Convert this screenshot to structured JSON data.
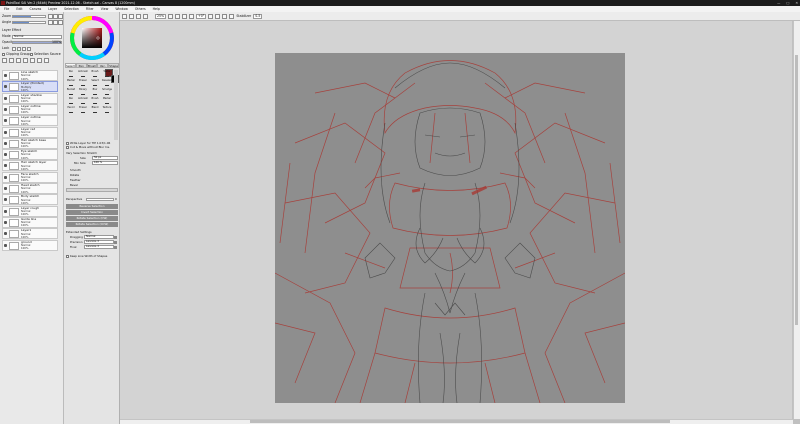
{
  "window": {
    "title": "PaintTool SAI Ver.2 (64bit) Preview 2021.12.06 - Sketch.sai - Canvas 8 (1200mm)",
    "buttons": [
      "—",
      "□",
      "✕"
    ]
  },
  "menu": [
    "File",
    "Edit",
    "Canvas",
    "Layer",
    "Selection",
    "Filter",
    "View",
    "Window",
    "Others",
    "Help"
  ],
  "toolbar": {
    "zoom": "25%",
    "angle": "+0°",
    "stabilizer_label": "Stabilizer",
    "stabilizer_value": "S-5"
  },
  "left": {
    "rows": [
      "Zoom",
      "Angle"
    ],
    "layer_effect": "Layer Effect",
    "mode_label": "Mode",
    "mode_value": "Normal",
    "opacity_label": "Opacity",
    "opacity_value": "100%",
    "lock_label": "Lock",
    "clipping_group": "Clipping Group",
    "selection_source": "Selection Source",
    "layers": [
      {
        "name": "Line sketch",
        "mode": "Normal",
        "opacity": "100%",
        "selected": false
      },
      {
        "name": "Layer (Pointed)",
        "mode": "Multiply",
        "opacity": "100%",
        "selected": true
      },
      {
        "name": "Layer shadow",
        "mode": "Normal",
        "opacity": "100%",
        "selected": false
      },
      {
        "name": "Layer outline",
        "mode": "Normal",
        "opacity": "100%",
        "selected": false
      },
      {
        "name": "Layer outline",
        "mode": "Normal",
        "opacity": "100%",
        "selected": false
      },
      {
        "name": "Layer red",
        "mode": "Normal",
        "opacity": "100%",
        "selected": false
      },
      {
        "name": "Hair sketch base",
        "mode": "Normal",
        "opacity": "100%",
        "selected": false
      },
      {
        "name": "Eye sketch",
        "mode": "Normal",
        "opacity": "100%",
        "selected": false
      },
      {
        "name": "Hair sketch layer",
        "mode": "Normal",
        "opacity": "100%",
        "selected": false
      },
      {
        "name": "Face sketch",
        "mode": "Normal",
        "opacity": "100%",
        "selected": false
      },
      {
        "name": "Head sketch",
        "mode": "Normal",
        "opacity": "100%",
        "selected": false
      },
      {
        "name": "Body sketch",
        "mode": "Normal",
        "opacity": "100%",
        "selected": false
      },
      {
        "name": "Layer rough",
        "mode": "Normal",
        "opacity": "100%",
        "selected": false
      },
      {
        "name": "Guide line",
        "mode": "Normal",
        "opacity": "100%",
        "selected": false
      },
      {
        "name": "Layer1",
        "mode": "Normal",
        "opacity": "100%",
        "selected": false
      },
      {
        "name": "ground",
        "mode": "Normal",
        "opacity": "100%",
        "selected": false
      }
    ]
  },
  "tools": {
    "tabs": [
      "Select",
      "Pen",
      "Brush",
      "Vec.",
      "Shape"
    ],
    "grid": [
      "Pen",
      "Airbrush",
      "Brush",
      "Water",
      "Marker",
      "Eraser",
      "Select",
      "Deselect",
      "Bucket",
      "Binary",
      "Blur",
      "Smudge",
      "Pen",
      "Airbrush",
      "Brush",
      "Marker",
      "Pencil",
      "Eraser",
      "Blend",
      "Texture"
    ],
    "options": [
      "Write Layer for TIE 1.03/1.06",
      "Cut & Move without Blur Ins."
    ],
    "section_title": "Vary Selection Stretch",
    "size_label": "Size",
    "size_value": "50 px",
    "min_label": "Min Size",
    "min_value": "100 %",
    "checks": [
      "Smooth",
      "Rotate",
      "Feather",
      "Bevel"
    ],
    "perspective_label": "Perspective",
    "perspective_value": "0",
    "buttons": [
      "Reverse Selection",
      "Invert Selection",
      "Rotate Selection (CW)",
      "Rotate Selection (CCW)"
    ],
    "extended_title": "Extended Settings",
    "dragging_label": "Dragging",
    "dragging_value": "Normal",
    "precision_label": "Precision",
    "precision_value": "Lanczos 3",
    "final_label": "Final",
    "final_value": "Lanczos 3",
    "keep_label": "Keep Line Width of Shapes"
  },
  "colors": {
    "primary": "#6b1a1a",
    "secondary": "#000000",
    "sketch_red": "#a83a35",
    "sketch_dark": "#4a4a4a",
    "paper": "#8e8e8e"
  }
}
